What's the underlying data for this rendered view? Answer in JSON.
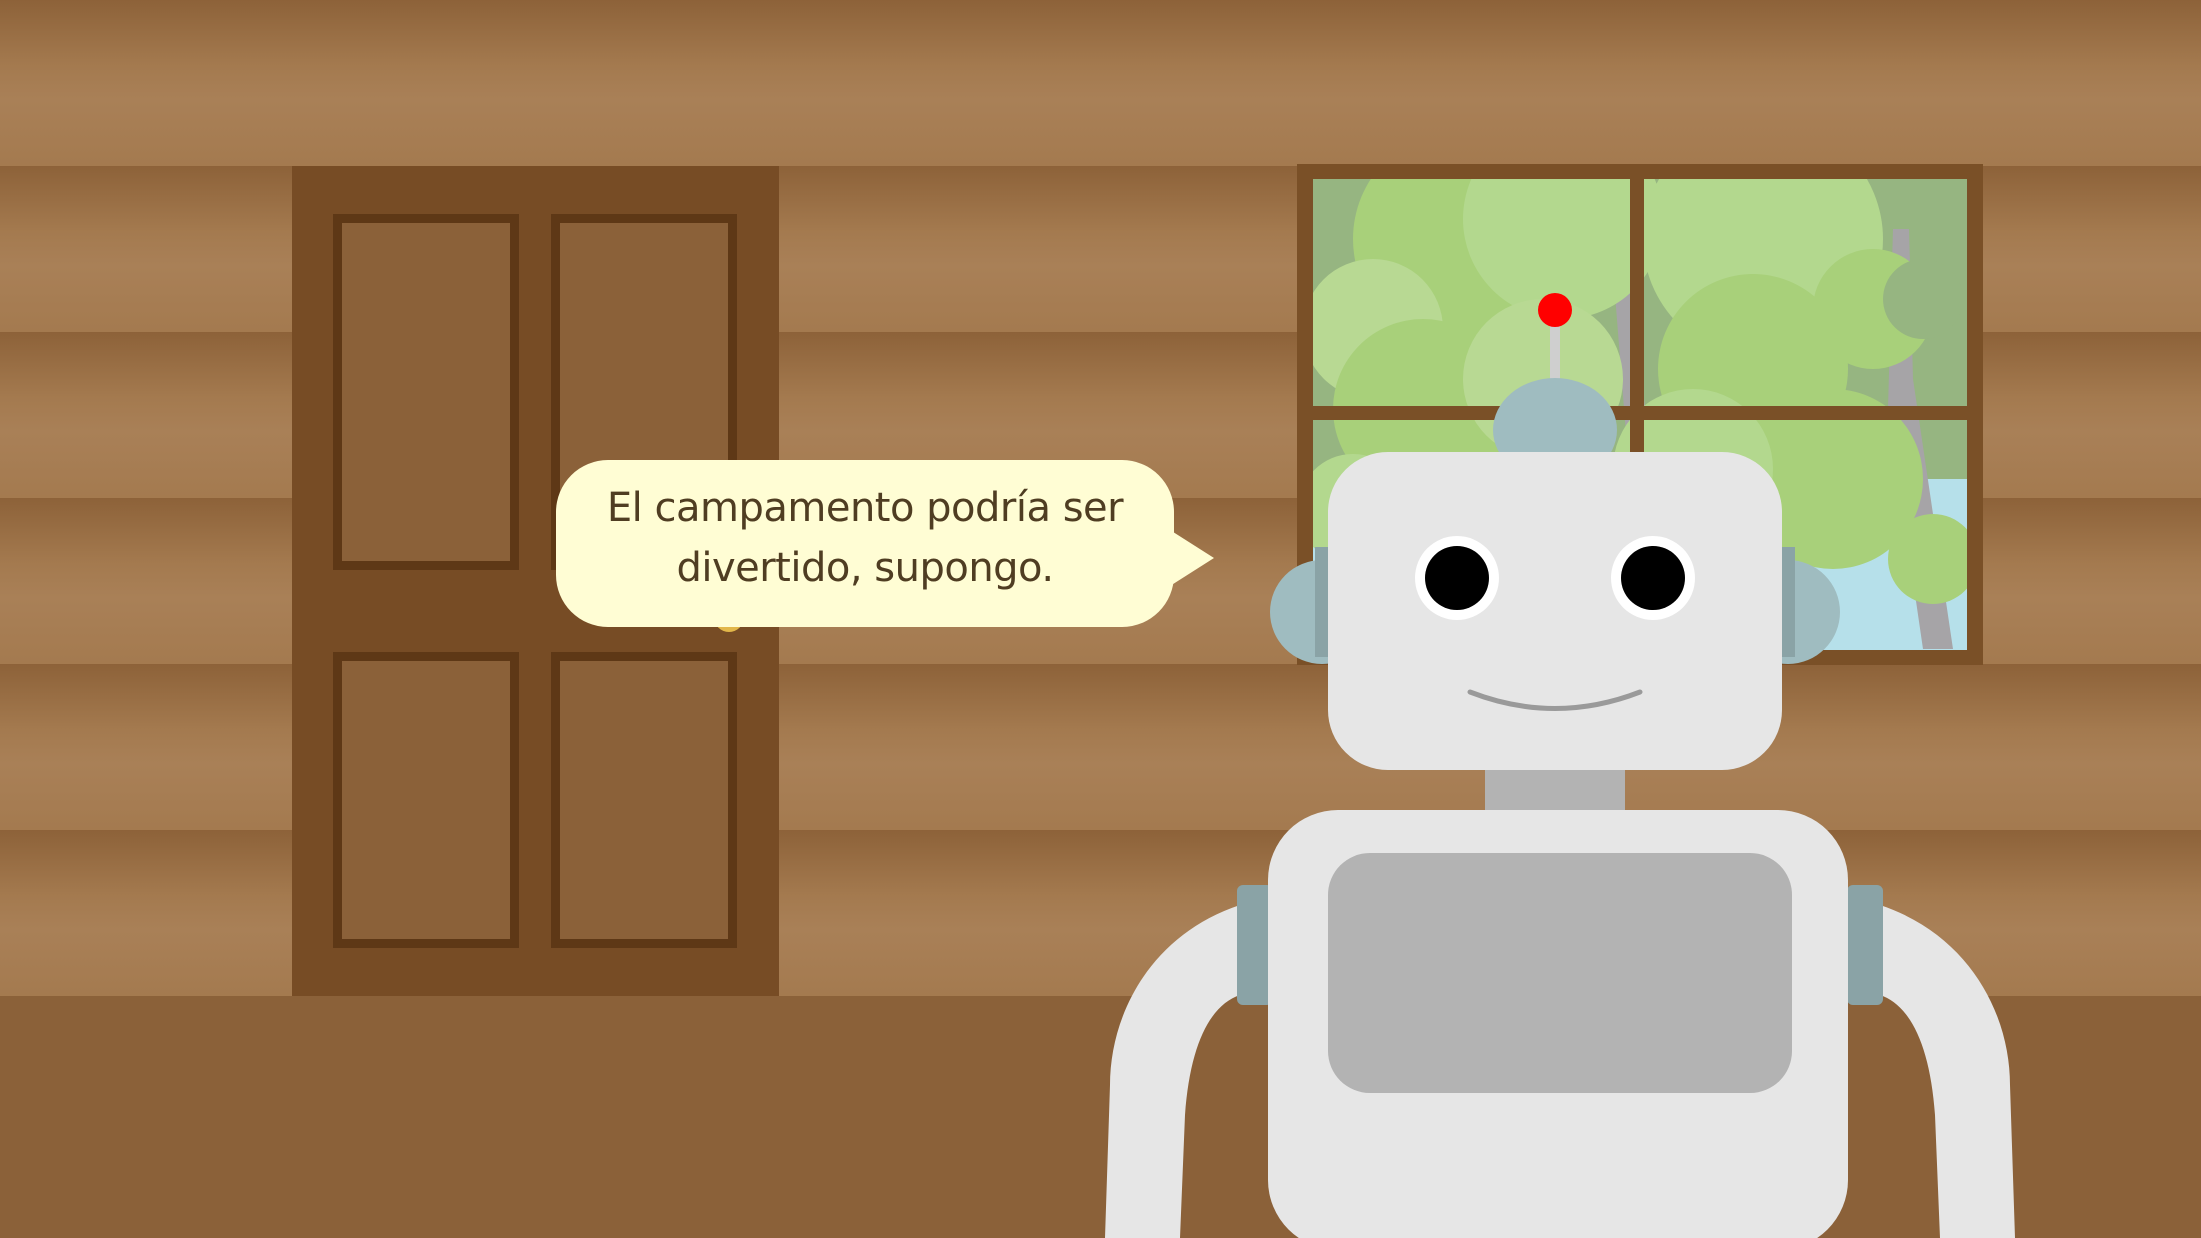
{
  "scene": {
    "type": "visual-novel-dialogue",
    "setting": "log-cabin-interior",
    "objects": [
      "wooden-door",
      "window-with-trees",
      "robot"
    ]
  },
  "dialogue": {
    "speaker": "robot",
    "line1": "El campamento podría ser",
    "line2": "divertido, supongo."
  },
  "colors": {
    "wall_plank": "#a47a4f",
    "door": "#774c25",
    "bubble": "#fffdd4",
    "dialogue_text": "#4f3d22",
    "robot_body": "#e6e6e6",
    "robot_accent": "#9fbcc0",
    "antenna_light": "#ff0000"
  }
}
